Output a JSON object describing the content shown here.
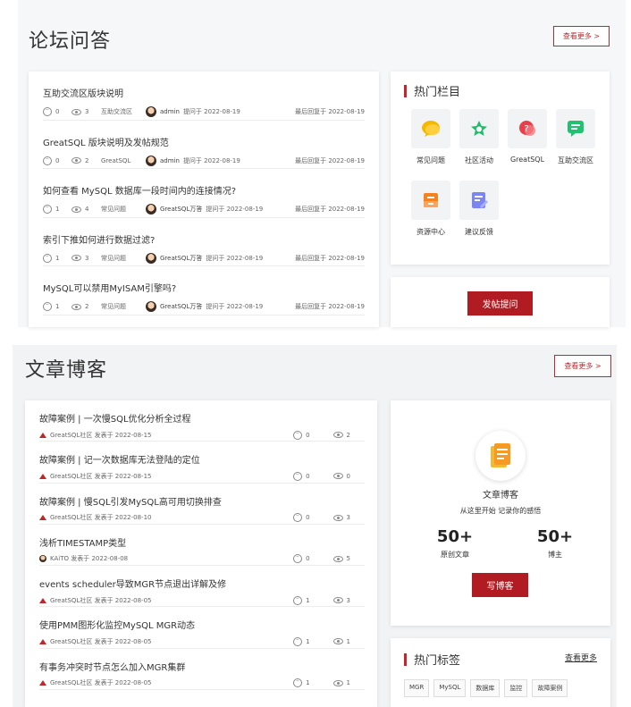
{
  "forum": {
    "title": "论坛问答",
    "more": "查看更多 >",
    "items": [
      {
        "title": "互助交流区版块说明",
        "comments": "0",
        "views": "3",
        "category": "互助交流区",
        "author": "admin",
        "posted": "提问于 2022-08-19",
        "last": "最后回复于 2022-08-19"
      },
      {
        "title": "GreatSQL 版块说明及发帖规范",
        "comments": "0",
        "views": "2",
        "category": "GreatSQL",
        "author": "admin",
        "posted": "提问于 2022-08-19",
        "last": "最后回复于 2022-08-19"
      },
      {
        "title": "如何查看 MySQL 数据库一段时间内的连接情况?",
        "comments": "1",
        "views": "4",
        "category": "常见问题",
        "author": "GreatSQL万答",
        "posted": "提问于 2022-08-19",
        "last": "最后回复于 2022-08-19"
      },
      {
        "title": "索引下推如何进行数据过滤?",
        "comments": "1",
        "views": "3",
        "category": "常见问题",
        "author": "GreatSQL万答",
        "posted": "提问于 2022-08-19",
        "last": "最后回复于 2022-08-19"
      },
      {
        "title": "MySQL可以禁用MyISAM引擎吗?",
        "comments": "1",
        "views": "2",
        "category": "常见问题",
        "author": "GreatSQL万答",
        "posted": "提问于 2022-08-19",
        "last": "最后回复于 2022-08-19"
      }
    ],
    "hot_columns": {
      "title": "热门栏目",
      "items": [
        {
          "label": "常见问题",
          "icon": "chat-bubble-icon",
          "color": "#f5b800"
        },
        {
          "label": "社区活动",
          "icon": "star-icon",
          "color": "#1bbf6a"
        },
        {
          "label": "GreatSQL",
          "icon": "question-icon",
          "color": "#e8404a"
        },
        {
          "label": "互助交流区",
          "icon": "message-icon",
          "color": "#20c270"
        },
        {
          "label": "资源中心",
          "icon": "archive-icon",
          "color": "#f5821f"
        },
        {
          "label": "建议反馈",
          "icon": "edit-doc-icon",
          "color": "#7b86f0"
        }
      ]
    },
    "post_button": "发帖提问"
  },
  "blog": {
    "title": "文章博客",
    "more": "查看更多 >",
    "items": [
      {
        "title": "故障案例 | 一次慢SQL优化分析全过程",
        "author": "GreatSQL社区",
        "posted": "发表于 2022-08-15",
        "comments": "0",
        "views": "2",
        "avatar": "logo"
      },
      {
        "title": "故障案例 | 记一次数据库无法登陆的定位",
        "author": "GreatSQL社区",
        "posted": "发表于 2022-08-15",
        "comments": "0",
        "views": "0",
        "avatar": "logo"
      },
      {
        "title": "故障案例 | 慢SQL引发MySQL高可用切换排查",
        "author": "GreatSQL社区",
        "posted": "发表于 2022-08-10",
        "comments": "0",
        "views": "3",
        "avatar": "logo"
      },
      {
        "title": "浅析TIMESTAMP类型",
        "author": "KAiTO",
        "posted": "发表于 2022-08-08",
        "comments": "0",
        "views": "5",
        "avatar": "user"
      },
      {
        "title": "events scheduler导致MGR节点退出详解及修",
        "author": "GreatSQL社区",
        "posted": "发表于 2022-08-05",
        "comments": "1",
        "views": "3",
        "avatar": "logo"
      },
      {
        "title": "使用PMM图形化监控MySQL MGR动态",
        "author": "GreatSQL社区",
        "posted": "发表于 2022-08-05",
        "comments": "1",
        "views": "1",
        "avatar": "logo"
      },
      {
        "title": "有事务冲突时节点怎么加入MGR集群",
        "author": "GreatSQL社区",
        "posted": "发表于 2022-08-05",
        "comments": "1",
        "views": "1",
        "avatar": "logo"
      }
    ],
    "side": {
      "name": "文章博客",
      "slogan": "从这里开始 记录你的感悟",
      "articles_num": "50+",
      "articles_label": "原创文章",
      "bloggers_num": "50+",
      "bloggers_label": "博主",
      "write_button": "写博客"
    },
    "tags": {
      "title": "热门标签",
      "more": "查看更多",
      "items": [
        "MGR",
        "MySQL",
        "数据库",
        "监控",
        "故障案例"
      ]
    }
  },
  "colors": {
    "accent": "#c0272d",
    "button": "#b01c22"
  }
}
